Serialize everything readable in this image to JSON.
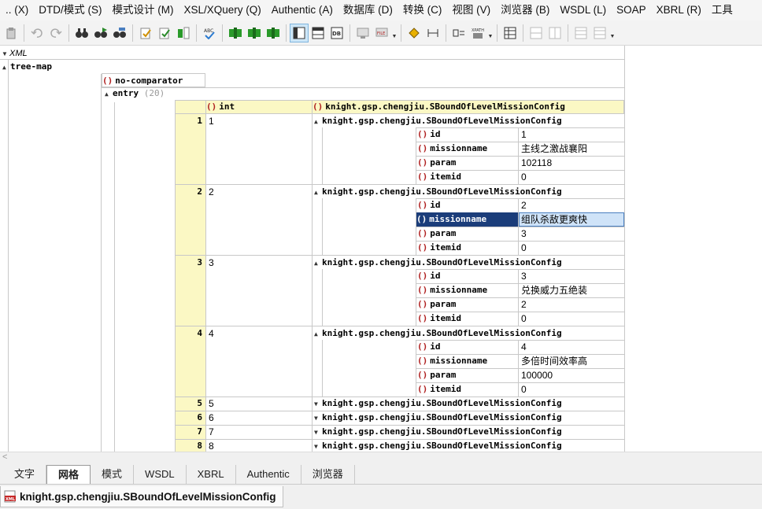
{
  "menu": [
    ".. (X)",
    "DTD/模式 (S)",
    "模式设计 (M)",
    "XSL/XQuery (Q)",
    "Authentic (A)",
    "数据库 (D)",
    "转换 (C)",
    "视图 (V)",
    "浏览器 (B)",
    "WSDL (L)",
    "SOAP",
    "XBRL (R)",
    "工具"
  ],
  "grid": {
    "root_label": "XML",
    "tree_map_label": "tree-map",
    "no_comparator_label": "no-comparator",
    "entry_label": "entry",
    "entry_count": "(20)",
    "col_int": "int",
    "col_class": "knight.gsp.chengjiu.SBoundOfLevelMissionConfig",
    "field_id": "id",
    "field_missionname": "missionname",
    "field_param": "param",
    "field_itemid": "itemid",
    "rows": [
      {
        "num": "1",
        "key": "1",
        "id": "1",
        "missionname": "主线之激战襄阳",
        "param": "102118",
        "itemid": "0"
      },
      {
        "num": "2",
        "key": "2",
        "id": "2",
        "missionname": "组队杀敌更爽快",
        "param": "3",
        "itemid": "0"
      },
      {
        "num": "3",
        "key": "3",
        "id": "3",
        "missionname": "兑换威力五绝装",
        "param": "2",
        "itemid": "0"
      },
      {
        "num": "4",
        "key": "4",
        "id": "4",
        "missionname": "多倍时间效率高",
        "param": "100000",
        "itemid": "0"
      }
    ],
    "collapsed_rows": [
      {
        "num": "5",
        "key": "5"
      },
      {
        "num": "6",
        "key": "6"
      },
      {
        "num": "7",
        "key": "7"
      },
      {
        "num": "8",
        "key": "8"
      }
    ]
  },
  "view_tabs": [
    "文字",
    "网格",
    "模式",
    "WSDL",
    "XBRL",
    "Authentic",
    "浏览器"
  ],
  "active_view_tab": "网格",
  "document_tab": "knight.gsp.chengjiu.SBoundOfLevelMissionConfig",
  "colors": {
    "header_yellow": "#fbf8c4",
    "bracket_red": "#b02020",
    "selection_dark": "#1b3d7a",
    "selection_light": "#cfe3f8"
  }
}
